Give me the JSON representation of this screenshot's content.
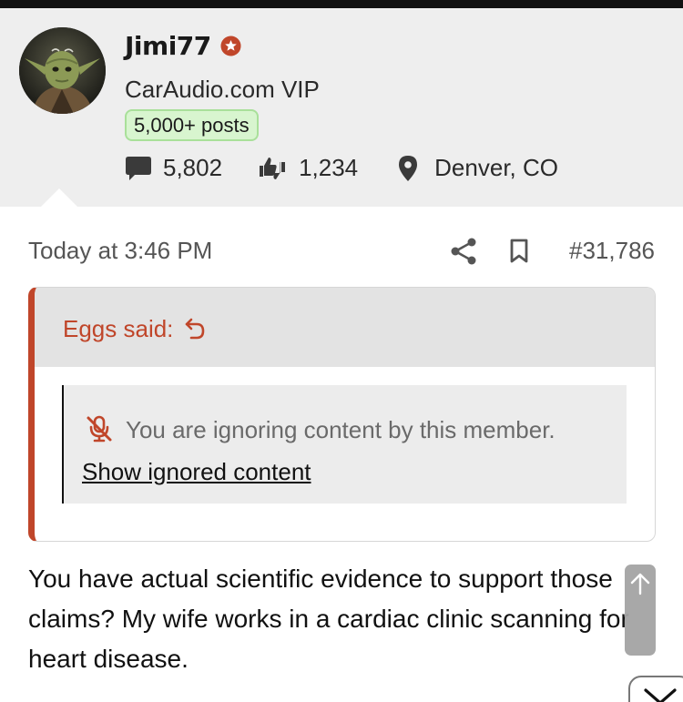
{
  "user": {
    "name": "Jimi77",
    "title": "CarAudio.com VIP",
    "badge": "5,000+ posts",
    "messages": "5,802",
    "reactions": "1,234",
    "location": "Denver, CO",
    "star_color": "#c0462a",
    "badge_color": "#d8f5cf"
  },
  "post": {
    "date": "Today at 3:46 PM",
    "number": "#31,786",
    "body": "You have actual scientific evidence to support those claims? My wife works in a cardiac clinic scanning for heart disease."
  },
  "quote": {
    "attribution": "Eggs said:",
    "ignored_text": "You are ignoring content by this member.",
    "show_ignored_label": "Show ignored content",
    "accent_color": "#c0462a"
  },
  "icons": {
    "messages": "speech-bubble-icon",
    "reactions": "thumbs-icon",
    "location": "map-pin-icon",
    "share": "share-icon",
    "bookmark": "bookmark-icon",
    "quote_jump": "return-arrow-icon",
    "ignored": "muted-mic-icon",
    "scroll_top": "arrow-up-icon",
    "scroll_down": "chevron-down-icon"
  }
}
